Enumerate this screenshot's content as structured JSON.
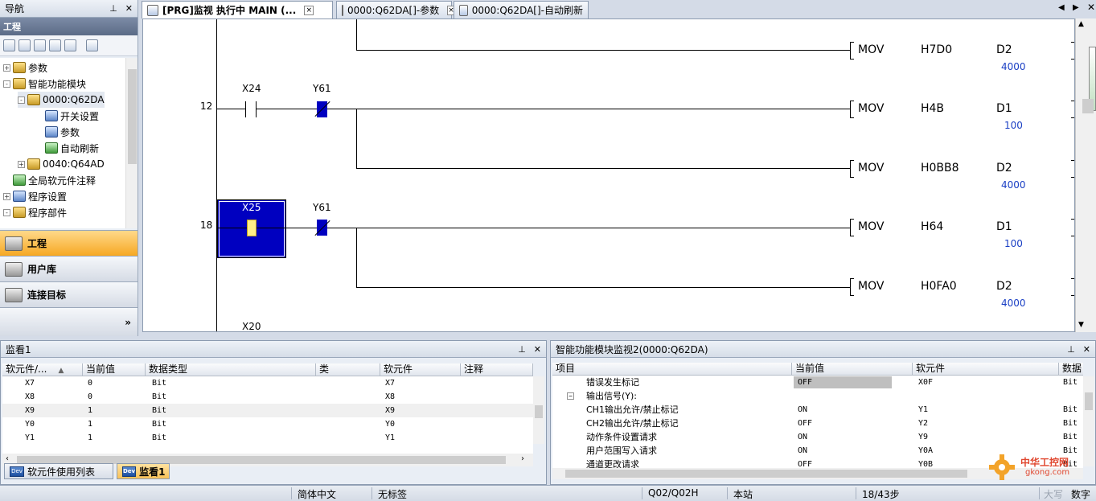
{
  "nav": {
    "title": "导航",
    "section": "工程",
    "tree": [
      {
        "label": "参数",
        "pm": "+"
      },
      {
        "label": "智能功能模块",
        "pm": "-"
      },
      {
        "label": "0000:Q62DA",
        "pm": "-"
      },
      {
        "label": "开关设置"
      },
      {
        "label": "参数"
      },
      {
        "label": "自动刷新"
      },
      {
        "label": "0040:Q64AD",
        "pm": "+"
      },
      {
        "label": "全局软元件注释"
      },
      {
        "label": "程序设置",
        "pm": "+"
      },
      {
        "label": "程序部件",
        "pm": "-"
      }
    ],
    "buttons": [
      "工程",
      "用户库",
      "连接目标"
    ]
  },
  "tabs": [
    {
      "label": "[PRG]监视 执行中 MAIN (...",
      "close": "×"
    },
    {
      "label": "0000:Q62DA[]-参数",
      "close": "×"
    },
    {
      "label": "0000:Q62DA[]-自动刷新"
    }
  ],
  "ladder": {
    "rungs": [
      {
        "step": "12",
        "contact1": "X24",
        "contact2": "Y61"
      },
      {
        "step": "18",
        "contact1": "X25",
        "contact2": "Y61"
      },
      {
        "step": "",
        "contact1": "X20"
      }
    ],
    "instructions": [
      {
        "op": "MOV",
        "src": "H7D0",
        "dst": "D2",
        "val": "4000"
      },
      {
        "op": "MOV",
        "src": "H4B",
        "dst": "D1",
        "val": "100"
      },
      {
        "op": "MOV",
        "src": "H0BB8",
        "dst": "D2",
        "val": "4000"
      },
      {
        "op": "MOV",
        "src": "H64",
        "dst": "D1",
        "val": "100"
      },
      {
        "op": "MOV",
        "src": "H0FA0",
        "dst": "D2",
        "val": "4000"
      }
    ]
  },
  "watch": {
    "title": "监看1",
    "columns": [
      "软元件/...",
      "当前值",
      "数据类型",
      "类",
      "软元件",
      "注释"
    ],
    "sort_indicator": "▲",
    "rows": [
      {
        "dev": "X7",
        "val": "0",
        "type": "Bit",
        "dev2": "X7"
      },
      {
        "dev": "X8",
        "val": "0",
        "type": "Bit",
        "dev2": "X8"
      },
      {
        "dev": "X9",
        "val": "1",
        "type": "Bit",
        "dev2": "X9"
      },
      {
        "dev": "Y0",
        "val": "1",
        "type": "Bit",
        "dev2": "Y0"
      },
      {
        "dev": "Y1",
        "val": "1",
        "type": "Bit",
        "dev2": "Y1"
      }
    ],
    "bottom_tabs": [
      "软元件使用列表",
      "监看1"
    ],
    "bottom_tab_icon": "Dev"
  },
  "module_monitor": {
    "title": "智能功能模块监视2(0000:Q62DA)",
    "columns": [
      "项目",
      "当前值",
      "软元件",
      "数据"
    ],
    "rows": [
      {
        "item": "错误发生标记",
        "val": "OFF",
        "dev": "X0F",
        "type": "Bit",
        "indent": 1
      },
      {
        "item": "输出信号(Y):",
        "val": "",
        "dev": "",
        "type": "",
        "indent": 0,
        "pm": "−"
      },
      {
        "item": "CH1输出允许/禁止标记",
        "val": "ON",
        "dev": "Y1",
        "type": "Bit",
        "indent": 1
      },
      {
        "item": "CH2输出允许/禁止标记",
        "val": "OFF",
        "dev": "Y2",
        "type": "Bit",
        "indent": 1
      },
      {
        "item": "动作条件设置请求",
        "val": "ON",
        "dev": "Y9",
        "type": "Bit",
        "indent": 1
      },
      {
        "item": "用户范围写入请求",
        "val": "ON",
        "dev": "Y0A",
        "type": "Bit",
        "indent": 1
      },
      {
        "item": "通道更改请求",
        "val": "OFF",
        "dev": "Y0B",
        "type": "Bit",
        "indent": 1
      }
    ]
  },
  "status": {
    "language": "简体中文",
    "label": "无标签",
    "cpu": "Q02/Q02H",
    "station": "本站",
    "steps": "18/43步",
    "caps": "大写",
    "num": "数字"
  },
  "watermark": {
    "line1": "中华工控网",
    "line2": "gkong.com"
  },
  "colors": {
    "accent": "#f6a823",
    "contact_active": "#0000c0",
    "value_text": "#1a3fc4"
  }
}
